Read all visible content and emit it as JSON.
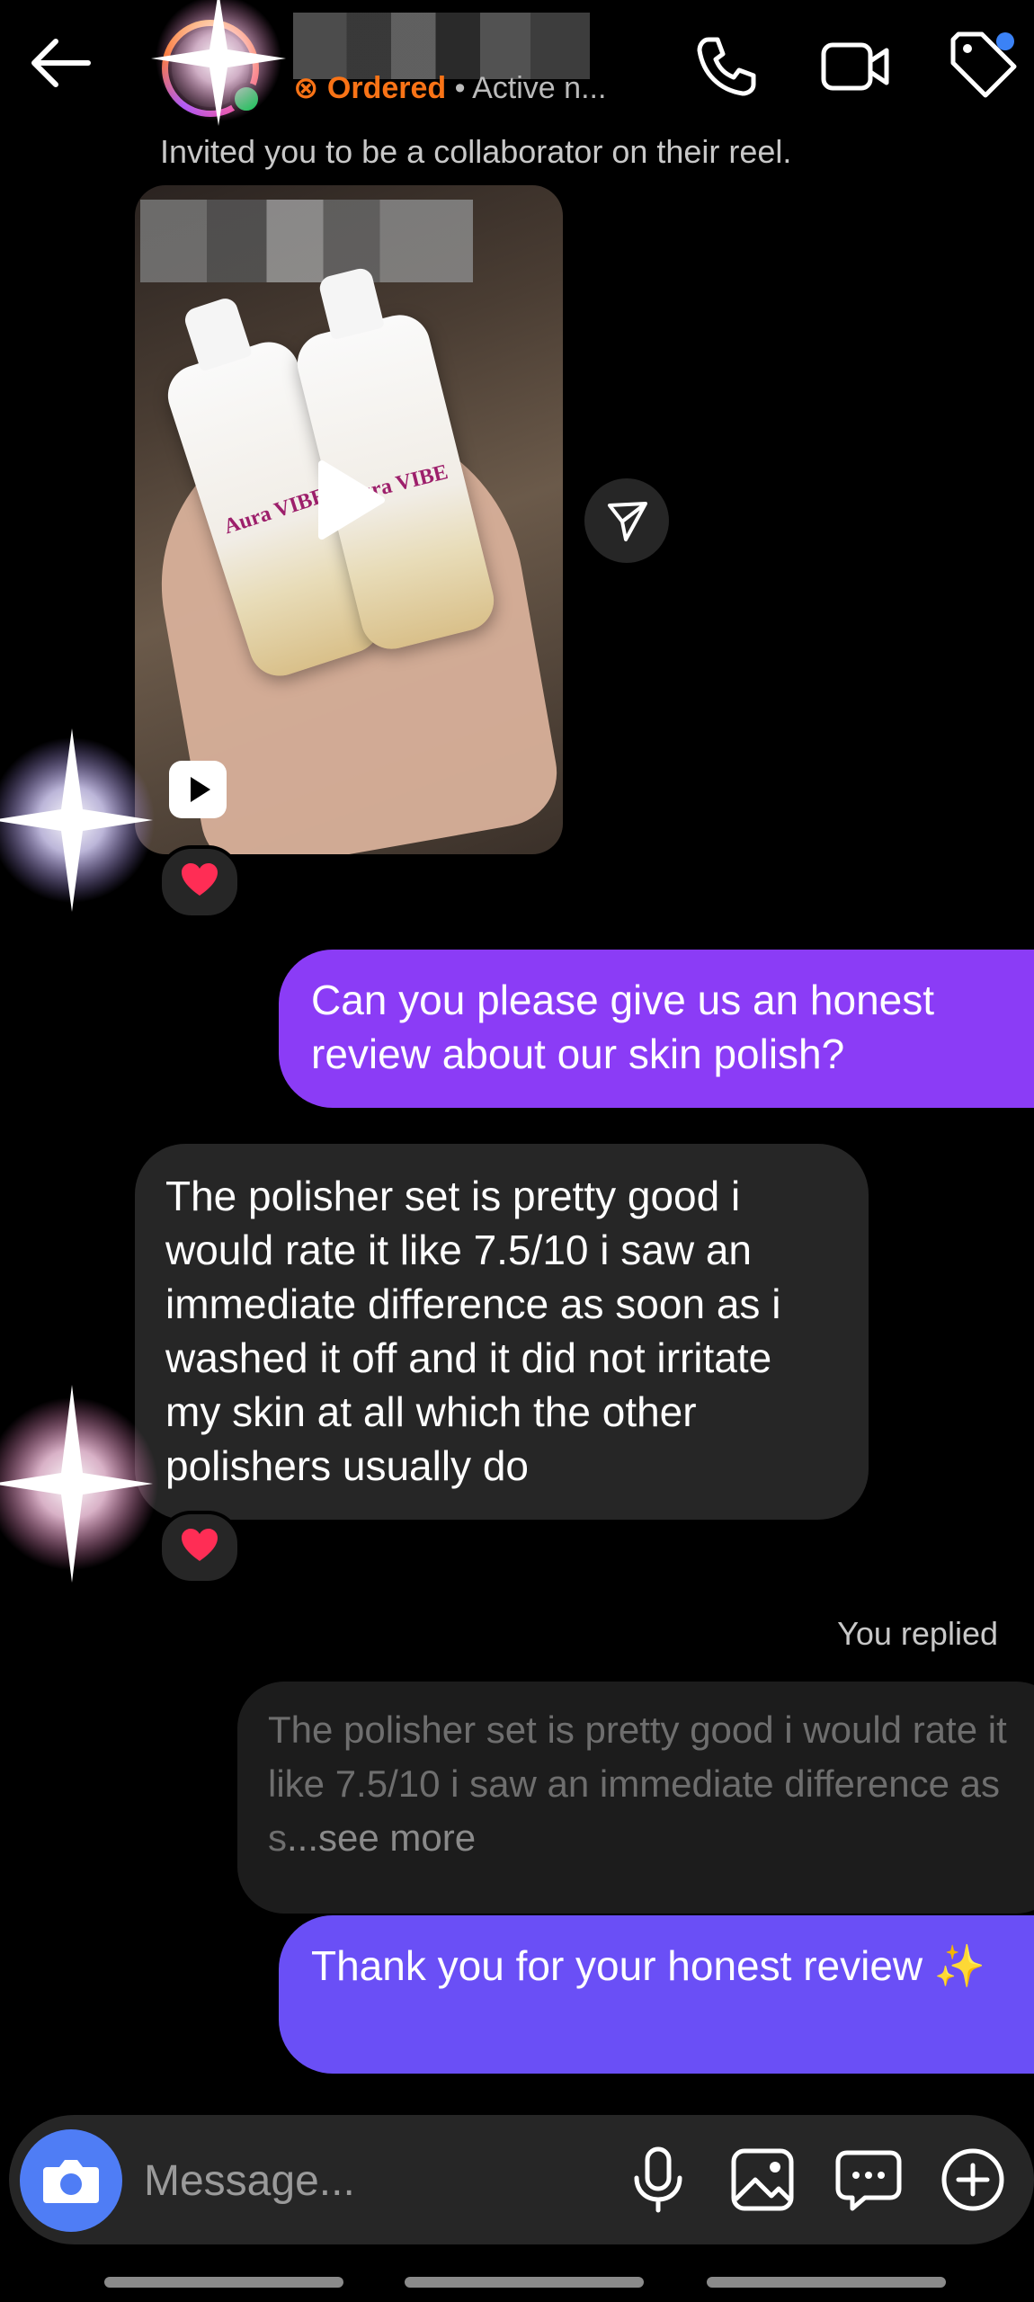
{
  "header": {
    "status_tag": "⊗ Ordered",
    "status_sep": " • ",
    "status_text": "Active n..."
  },
  "thread": {
    "invite_text": "Invited you to be a collaborator on their reel.",
    "reel": {
      "bottle_label": "Aura VIBE"
    },
    "messages": {
      "out1": "Can you please give us an honest review about our skin polish?",
      "in1": "The polisher set is pretty good i would rate it like 7.5/10 i saw an immediate difference as soon as i washed it off and it did not irritate my skin at all which the other polishers usually do",
      "replied_label": "You replied",
      "quote_text": "The polisher set is pretty good i would rate it like 7.5/10 i saw an immediate difference as s",
      "quote_more": "...see more",
      "out2": "Thank you for your honest review ✨"
    },
    "reaction_icon": "heart-icon"
  },
  "composer": {
    "placeholder": "Message..."
  },
  "colors": {
    "outgoing_bubble_1": "#8b3cf6",
    "outgoing_bubble_2": "#6a4ff6",
    "incoming_bubble": "#262626",
    "camera_button": "#4f7df5",
    "status_tag": "#f97316"
  }
}
